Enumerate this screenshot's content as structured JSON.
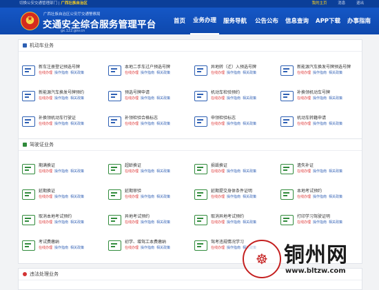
{
  "topbar": {
    "switch_text": "切换公安交通管理部门",
    "region": "广西壮族自治区",
    "home": "我的主页",
    "message": "消息",
    "logout": "退出"
  },
  "header": {
    "org": "广西壮族自治区公安厅交通警察局",
    "title": "交通安全综合服务管理平台",
    "url": "gx.122.gov.cn"
  },
  "nav": [
    "首页",
    "业务办理",
    "服务导航",
    "公告公布",
    "信息查询",
    "APP下载",
    "办事指南"
  ],
  "nav_active": 1,
  "links": [
    "在线办理",
    "操作指南",
    "相关政策"
  ],
  "colors": {
    "brand_blue": "#0e48ad",
    "vehicle_section": "#2d5fb3",
    "license_section": "#2f8a3a",
    "violation_section": "#d33333",
    "online_link": "#dd3333"
  },
  "vehicle": {
    "title": "机动车业务",
    "items": [
      "新车注册登记预选号牌",
      "本地二手车过户预选号牌",
      "异地转（迁）入预选号牌",
      "新能源汽车换发号牌预选号牌",
      "新能源汽车换发号牌预约",
      "预选号牌申请",
      "机动车检验预约",
      "补换领机动车号牌",
      "补换领机动车行驶证",
      "补领检验合格标志",
      "申领检验标志",
      "机动车转籍申请"
    ]
  },
  "license": {
    "title": "驾驶证业务",
    "items": [
      "期满换证",
      "超龄换证",
      "损毁换证",
      "遗失补证",
      "延期换证",
      "延期审验",
      "延期提交身体条件证明",
      "本地考试预约",
      "取消本地考试预约",
      "异地考试预约",
      "取消异地考试预约",
      "打印学习驾驶证明",
      "考试费缴纳",
      "初学、增驾工本费缴纳",
      "驾考违规情况学习"
    ]
  },
  "violation": {
    "title": "违法处理业务"
  },
  "watermark": {
    "site": "铜州网",
    "url": "www.bltzw.com"
  }
}
